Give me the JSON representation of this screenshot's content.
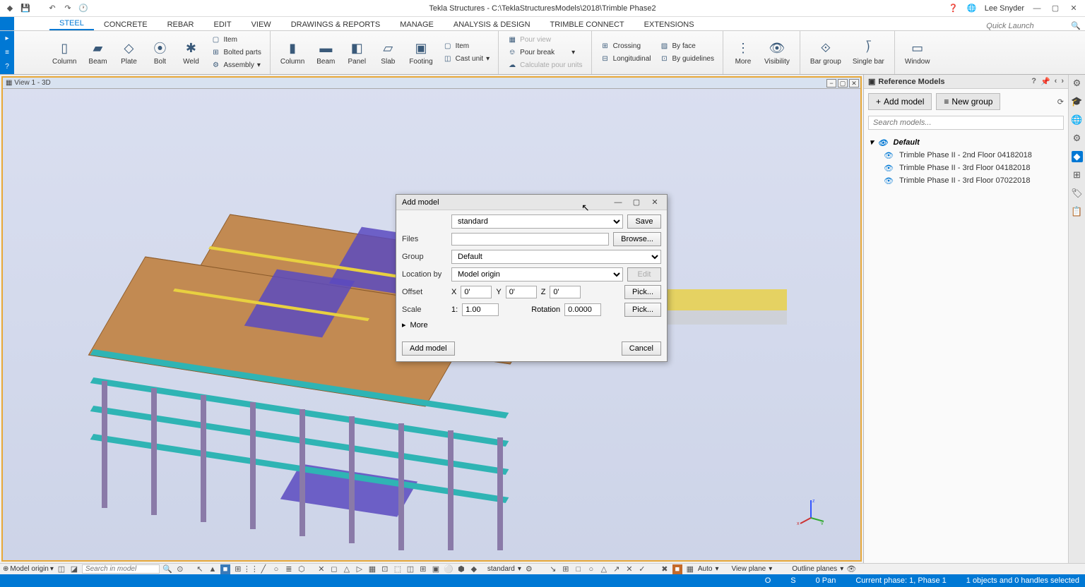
{
  "titlebar": {
    "title": "Tekla Structures - C:\\TeklaStructuresModels\\2018\\Trimble Phase2",
    "user": "Lee Snyder"
  },
  "quick_launch": {
    "placeholder": "Quick Launch"
  },
  "tabs": {
    "steel": "STEEL",
    "concrete": "CONCRETE",
    "rebar": "REBAR",
    "edit": "EDIT",
    "view": "VIEW",
    "drawings": "DRAWINGS & REPORTS",
    "manage": "MANAGE",
    "analysis": "ANALYSIS & DESIGN",
    "trimble": "TRIMBLE CONNECT",
    "extensions": "EXTENSIONS"
  },
  "ribbon": {
    "column": "Column",
    "beam": "Beam",
    "plate": "Plate",
    "bolt": "Bolt",
    "weld": "Weld",
    "item": "Item",
    "bolted": "Bolted parts",
    "assembly": "Assembly",
    "column2": "Column",
    "beam2": "Beam",
    "panel": "Panel",
    "slab": "Slab",
    "footing": "Footing",
    "item2": "Item",
    "castunit": "Cast unit",
    "pourview": "Pour view",
    "pourbreak": "Pour break",
    "calcpour": "Calculate pour units",
    "crossing": "Crossing",
    "longitudinal": "Longitudinal",
    "byface": "By face",
    "byguidelines": "By guidelines",
    "more": "More",
    "visibility": "Visibility",
    "bargroup": "Bar group",
    "singlebar": "Single bar",
    "window": "Window"
  },
  "view": {
    "title": "View 1 - 3D"
  },
  "panel": {
    "title": "Reference Models",
    "add_model": "Add model",
    "new_group": "New group",
    "search": "Search models...",
    "group": "Default",
    "items": [
      "Trimble Phase II - 2nd Floor 04182018",
      "Trimble Phase II - 3rd Floor 04182018",
      "Trimble Phase II - 3rd Floor 07022018"
    ]
  },
  "dialog": {
    "title": "Add model",
    "preset": "standard",
    "save": "Save",
    "files": "Files",
    "browse": "Browse...",
    "group_lbl": "Group",
    "group_val": "Default",
    "location_lbl": "Location by",
    "location_val": "Model origin",
    "edit": "Edit",
    "offset": "Offset",
    "x": "X",
    "y": "Y",
    "z": "Z",
    "xval": "0'",
    "yval": "0'",
    "zval": "0'",
    "pick": "Pick...",
    "scale": "Scale",
    "one": "1:",
    "scale_val": "1.00",
    "rotation": "Rotation",
    "rot_val": "0.0000",
    "more": "More",
    "add": "Add model",
    "cancel": "Cancel"
  },
  "bottombar": {
    "origin": "Model origin",
    "search": "Search in model",
    "standard": "standard",
    "auto": "Auto",
    "viewplane": "View plane",
    "outline": "Outline planes"
  },
  "status": {
    "o": "O",
    "s": "S",
    "pan": "0 Pan",
    "phase": "Current phase: 1, Phase 1",
    "sel": "1 objects and 0 handles selected"
  }
}
